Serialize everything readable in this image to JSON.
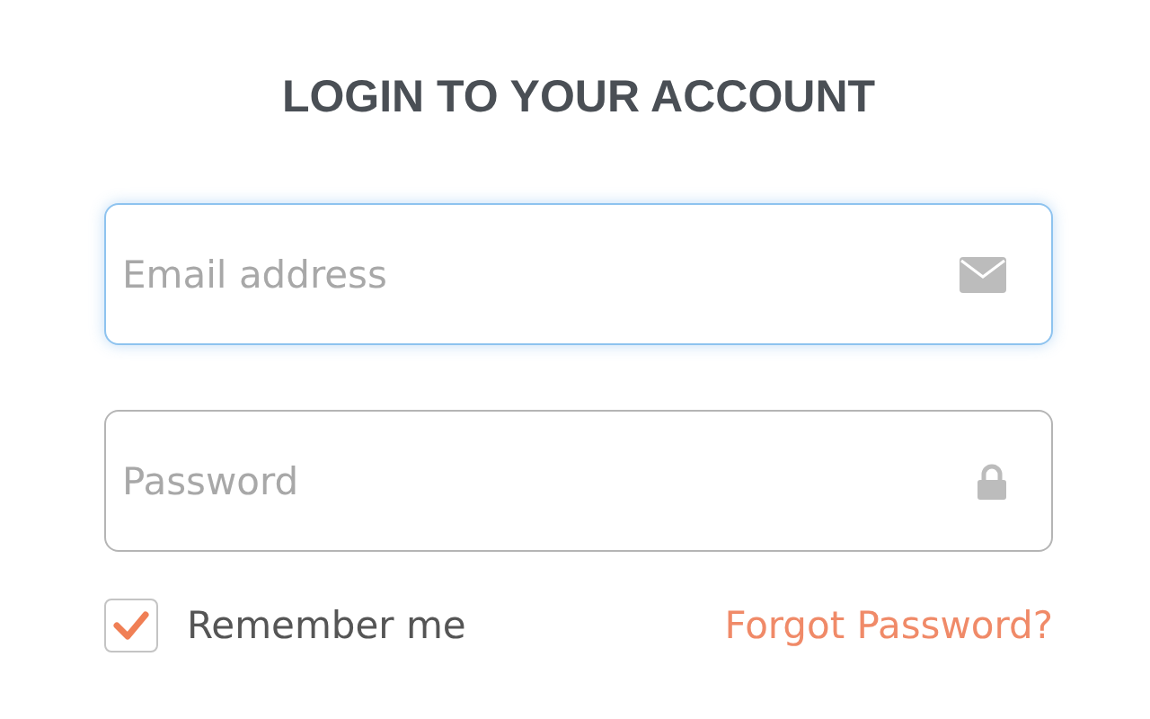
{
  "title": "LOGIN TO YOUR ACCOUNT",
  "fields": [
    {
      "kind": "email",
      "placeholder": "Email address",
      "focused": true
    },
    {
      "kind": "password",
      "placeholder": "Password",
      "focused": false
    }
  ],
  "remember": {
    "label": "Remember me",
    "checked": true
  },
  "forgot_link": "Forgot Password?"
}
